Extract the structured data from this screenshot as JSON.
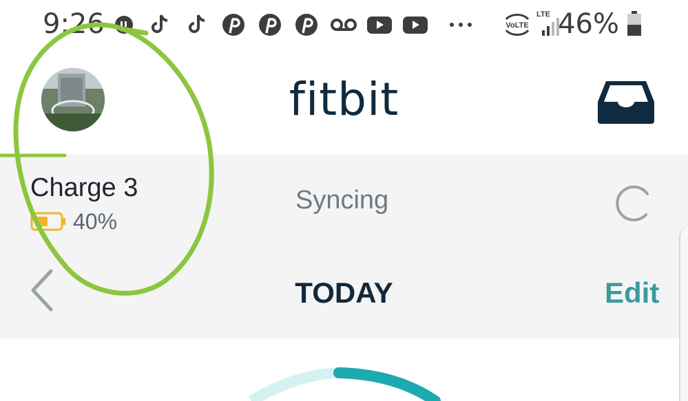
{
  "status_bar": {
    "time": "9:26",
    "battery_percent": "46%",
    "notification_icons": [
      "app-notification-icon",
      "tiktok-icon",
      "tiktok-icon",
      "pinterest-icon",
      "pinterest-icon",
      "pinterest-icon",
      "voicemail-icon",
      "youtube-icon",
      "youtube-icon",
      "more-dots-icon"
    ],
    "network_label_volte": "VoLTE",
    "network_label_lte": "LTE"
  },
  "header": {
    "logo_text": "fitbit"
  },
  "device": {
    "name": "Charge 3",
    "battery_percent": "40%",
    "sync_status": "Syncing"
  },
  "day_nav": {
    "title": "TODAY",
    "edit_label": "Edit"
  },
  "colors": {
    "accent_teal": "#3b9aa0",
    "ring_teal": "#1fa9b1",
    "annotation_green": "#8cc63f",
    "battery_amber": "#f0b429",
    "panel_bg": "#f4f4f4",
    "navy": "#102b3f"
  }
}
